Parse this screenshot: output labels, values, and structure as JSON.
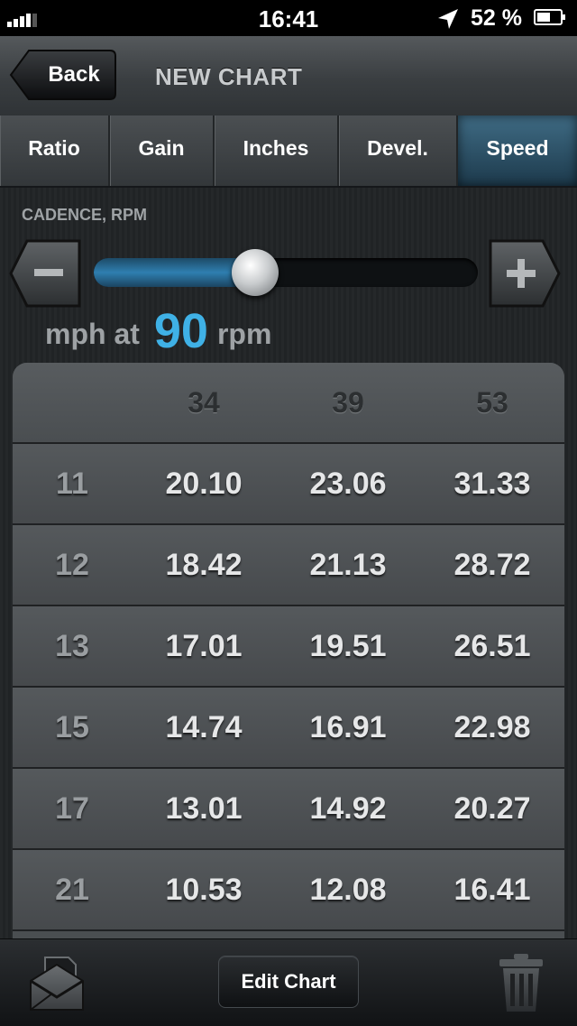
{
  "status_bar": {
    "time": "16:41",
    "battery_percent": "52 %",
    "icons": [
      "signal-icon",
      "location-arrow-icon",
      "battery-icon"
    ]
  },
  "nav": {
    "back_label": "Back",
    "title": "NEW CHART"
  },
  "tabs": [
    {
      "label": "Ratio",
      "active": false
    },
    {
      "label": "Gain",
      "active": false
    },
    {
      "label": "Inches",
      "active": false
    },
    {
      "label": "Devel.",
      "active": false
    },
    {
      "label": "Speed",
      "active": true
    }
  ],
  "cadence": {
    "label": "CADENCE, RPM",
    "prefix": "mph at",
    "value": "90",
    "unit": "rpm",
    "slider_fraction": 0.42,
    "minus_icon": "minus-icon",
    "plus_icon": "plus-icon"
  },
  "table": {
    "columns": [
      "",
      "34",
      "39",
      "53"
    ],
    "rows": [
      {
        "cog": "11",
        "values": [
          "20.10",
          "23.06",
          "31.33"
        ]
      },
      {
        "cog": "12",
        "values": [
          "18.42",
          "21.13",
          "28.72"
        ]
      },
      {
        "cog": "13",
        "values": [
          "17.01",
          "19.51",
          "26.51"
        ]
      },
      {
        "cog": "15",
        "values": [
          "14.74",
          "16.91",
          "22.98"
        ]
      },
      {
        "cog": "17",
        "values": [
          "13.01",
          "14.92",
          "20.27"
        ]
      },
      {
        "cog": "21",
        "values": [
          "10.53",
          "12.08",
          "16.41"
        ]
      }
    ]
  },
  "toolbar": {
    "edit_label": "Edit Chart",
    "mail_icon": "mail-icon",
    "trash_icon": "trash-icon"
  },
  "colors": {
    "accent": "#3fb1e6",
    "active_tab": "#2b5670"
  }
}
